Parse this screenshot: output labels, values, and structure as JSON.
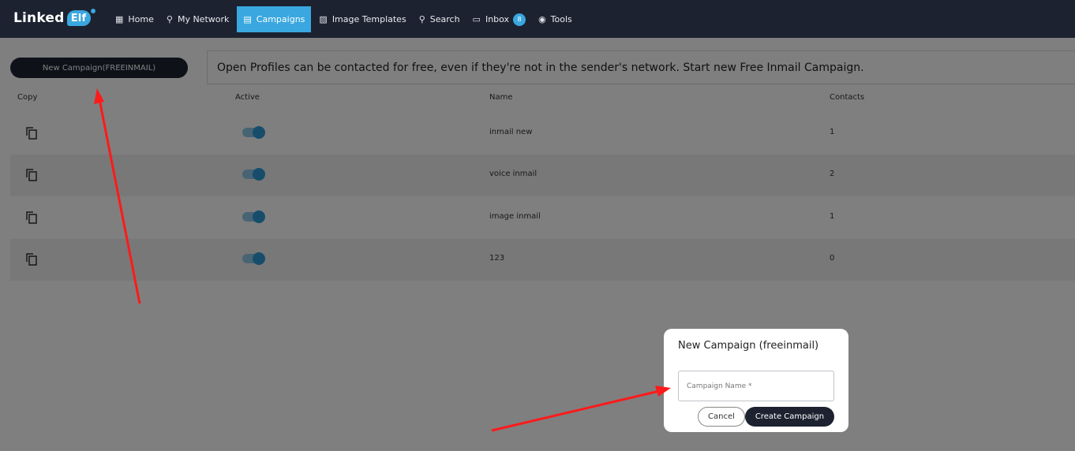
{
  "app": {
    "logo_text": "Linked",
    "logo_badge": "Elf"
  },
  "nav": {
    "items": [
      {
        "label": "Home",
        "icon": "dashboard-icon"
      },
      {
        "label": "My Network",
        "icon": "network-icon"
      },
      {
        "label": "Campaigns",
        "icon": "grid-icon",
        "active": true
      },
      {
        "label": "Image Templates",
        "icon": "image-icon"
      },
      {
        "label": "Search",
        "icon": "search-icon"
      },
      {
        "label": "Inbox",
        "icon": "inbox-icon",
        "badge": "8"
      },
      {
        "label": "Tools",
        "icon": "eye-icon"
      }
    ]
  },
  "toolbar": {
    "new_campaign_label": "New Campaign(FREEINMAIL)"
  },
  "info": {
    "text": "Open Profiles can be contacted for free, even if they're not in the sender's network. Start new Free Inmail Campaign."
  },
  "table": {
    "columns": [
      "Copy",
      "Active",
      "Name",
      "Contacts"
    ],
    "rows": [
      {
        "name": "inmail new",
        "contacts": "1",
        "active": true
      },
      {
        "name": "voice inmail",
        "contacts": "2",
        "active": true
      },
      {
        "name": "image inmail",
        "contacts": "1",
        "active": true
      },
      {
        "name": "123",
        "contacts": "0",
        "active": true
      }
    ]
  },
  "modal": {
    "title": "New Campaign (freeinmail)",
    "input_placeholder": "Campaign Name *",
    "cancel_label": "Cancel",
    "create_label": "Create Campaign"
  },
  "colors": {
    "nav_bg": "#1c2230",
    "accent": "#3aa7e0",
    "annotation_arrow": "#ff1a1a"
  }
}
